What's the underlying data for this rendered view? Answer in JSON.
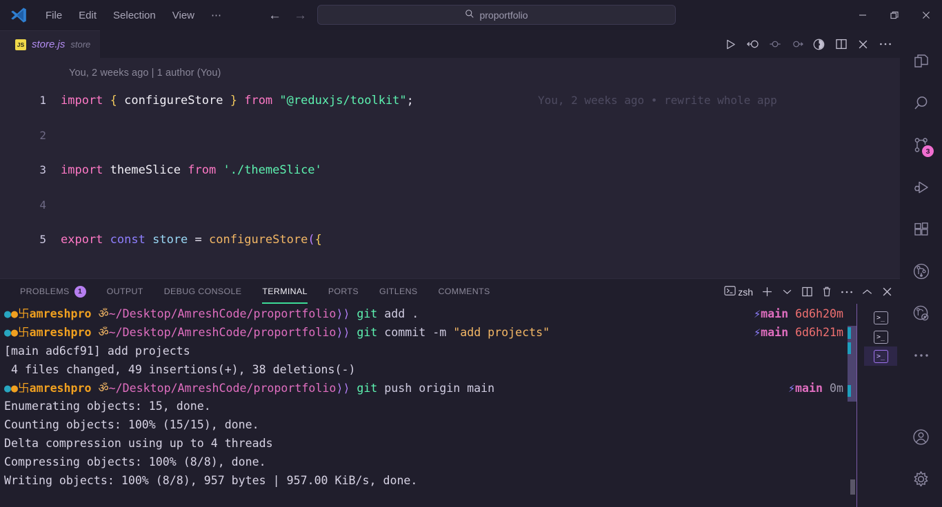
{
  "titlebar": {
    "logo_icon": "vscode-logo-icon",
    "menus": [
      {
        "label": "File"
      },
      {
        "label": "Edit"
      },
      {
        "label": "Selection"
      },
      {
        "label": "View"
      },
      {
        "label": "⋯"
      }
    ],
    "nav": {
      "back_icon": "arrow-left-icon",
      "forward_icon": "arrow-right-icon"
    },
    "search": {
      "icon": "search-icon",
      "value": "proportfolio"
    },
    "window": {
      "minimize": "—",
      "maximize": "❐",
      "close": "✕"
    }
  },
  "tabbar": {
    "tab": {
      "badge": "JS",
      "name": "store.js",
      "description": "store"
    },
    "actions": [
      {
        "name": "run-code-button",
        "glyph": "▷"
      },
      {
        "name": "gitlens-compare-icon",
        "glyph": "←○"
      },
      {
        "name": "gitlens-previous-change-icon",
        "glyph": "⊸"
      },
      {
        "name": "gitlens-next-change-icon",
        "glyph": "⊸"
      },
      {
        "name": "gitlens-blame-toggle-icon",
        "glyph": "◔"
      },
      {
        "name": "split-editor-right-icon",
        "glyph": "◫"
      },
      {
        "name": "close-editor-icon",
        "glyph": "✕"
      },
      {
        "name": "more-editor-actions-icon",
        "glyph": "⋯"
      }
    ]
  },
  "editor": {
    "blame_header": "You, 2 weeks ago | 1 author (You)",
    "inline_blame": "You, 2 weeks ago • rewrite whole app",
    "lines": [
      {
        "num": "1",
        "tokens": [
          {
            "t": "import",
            "c": "kw"
          },
          {
            "t": " ",
            "c": "op"
          },
          {
            "t": "{",
            "c": "br"
          },
          {
            "t": " ",
            "c": "op"
          },
          {
            "t": "configureStore",
            "c": "ident"
          },
          {
            "t": " ",
            "c": "op"
          },
          {
            "t": "}",
            "c": "br"
          },
          {
            "t": " ",
            "c": "op"
          },
          {
            "t": "from",
            "c": "kw"
          },
          {
            "t": " ",
            "c": "op"
          },
          {
            "t": "\"@reduxjs/toolkit\"",
            "c": "str"
          },
          {
            "t": ";",
            "c": "op"
          }
        ]
      },
      {
        "num": "2",
        "tokens": []
      },
      {
        "num": "3",
        "tokens": [
          {
            "t": "import",
            "c": "kw"
          },
          {
            "t": " ",
            "c": "op"
          },
          {
            "t": "themeSlice",
            "c": "ident"
          },
          {
            "t": " ",
            "c": "op"
          },
          {
            "t": "from",
            "c": "kw"
          },
          {
            "t": " ",
            "c": "op"
          },
          {
            "t": "'./themeSlice'",
            "c": "str"
          }
        ]
      },
      {
        "num": "4",
        "tokens": []
      },
      {
        "num": "5",
        "tokens": [
          {
            "t": "export",
            "c": "kw"
          },
          {
            "t": " ",
            "c": "op"
          },
          {
            "t": "const",
            "c": "kw2"
          },
          {
            "t": " ",
            "c": "op"
          },
          {
            "t": "store",
            "c": "var"
          },
          {
            "t": " ",
            "c": "op"
          },
          {
            "t": "=",
            "c": "op"
          },
          {
            "t": " ",
            "c": "op"
          },
          {
            "t": "configureStore",
            "c": "fn"
          },
          {
            "t": "(",
            "c": "br2"
          },
          {
            "t": "{",
            "c": "br"
          }
        ]
      }
    ]
  },
  "panel": {
    "tabs": [
      {
        "label": "PROBLEMS",
        "badge": "1",
        "active": false
      },
      {
        "label": "OUTPUT",
        "badge": "",
        "active": false
      },
      {
        "label": "DEBUG CONSOLE",
        "badge": "",
        "active": false
      },
      {
        "label": "TERMINAL",
        "badge": "",
        "active": true
      },
      {
        "label": "PORTS",
        "badge": "",
        "active": false
      },
      {
        "label": "GITLENS",
        "badge": "",
        "active": false
      },
      {
        "label": "COMMENTS",
        "badge": "",
        "active": false
      }
    ],
    "actions": {
      "shell_icon": "terminal-icon",
      "shell_label": "zsh",
      "new_terminal_icon": "plus-icon",
      "new_terminal_dropdown_icon": "chevron-down-icon",
      "split_icon": "split-terminal-icon",
      "kill_icon": "trash-icon",
      "more_icon": "more-actions-icon",
      "maximize_icon": "chevron-up-icon",
      "close_icon": "close-icon"
    }
  },
  "terminal": {
    "prompt": {
      "dot": "●",
      "circle": "●",
      "symbol": "卐",
      "user": "amreshpro",
      "om": "ॐ",
      "path": "~/Desktop/AmreshCode/proportfolio",
      "arrow": "⟩⟩"
    },
    "lines": [
      {
        "type": "prompt",
        "cmd": "git",
        "args": " add .",
        "branch": "main",
        "time": "6d6h20m",
        "dim": false
      },
      {
        "type": "prompt",
        "cmd": "git",
        "args": " commit -m ",
        "str": "\"add projects\"",
        "branch": "main",
        "time": "6d6h21m",
        "dim": false
      },
      {
        "type": "output",
        "text": "[main ad6cf91] add projects"
      },
      {
        "type": "output",
        "text": " 4 files changed, 49 insertions(+), 38 deletions(-)"
      },
      {
        "type": "prompt",
        "cmd": "git",
        "args": " push origin main",
        "branch": "main",
        "time": "0m",
        "dim": true
      },
      {
        "type": "output",
        "text": "Enumerating objects: 15, done."
      },
      {
        "type": "output",
        "text": "Counting objects: 100% (15/15), done."
      },
      {
        "type": "output",
        "text": "Delta compression using up to 4 threads"
      },
      {
        "type": "output",
        "text": "Compressing objects: 100% (8/8), done."
      },
      {
        "type": "output",
        "text": "Writing objects: 100% (8/8), 957 bytes | 957.00 KiB/s, done."
      }
    ],
    "branch_bolt": "⚡",
    "instances": [
      {
        "name": "terminal-instance-1",
        "selected": false
      },
      {
        "name": "terminal-instance-2",
        "selected": false
      },
      {
        "name": "terminal-instance-3",
        "selected": true
      }
    ]
  },
  "activitybar": {
    "items": [
      {
        "name": "explorer",
        "icon": "files-icon",
        "badge": ""
      },
      {
        "name": "search",
        "icon": "search-icon",
        "badge": ""
      },
      {
        "name": "source-control",
        "icon": "source-control-icon",
        "badge": "3"
      },
      {
        "name": "run-and-debug",
        "icon": "run-debug-icon",
        "badge": ""
      },
      {
        "name": "extensions",
        "icon": "extensions-icon",
        "badge": ""
      },
      {
        "name": "gitlens",
        "icon": "gitlens-icon",
        "badge": ""
      },
      {
        "name": "gitlens-inspect",
        "icon": "gitlens-inspect-icon",
        "badge": ""
      },
      {
        "name": "more-views",
        "icon": "more-icon",
        "badge": ""
      }
    ],
    "bottom": [
      {
        "name": "accounts",
        "icon": "account-icon"
      },
      {
        "name": "manage-settings",
        "icon": "gear-icon"
      }
    ]
  },
  "colors": {
    "editor_bg": "#272434",
    "panel_bg": "#201e2c",
    "titlebar_bg": "#1f1d2b",
    "accent_green": "#3ddc97",
    "badge_purple": "#b67ef0",
    "badge_pink": "#f06ed0"
  }
}
